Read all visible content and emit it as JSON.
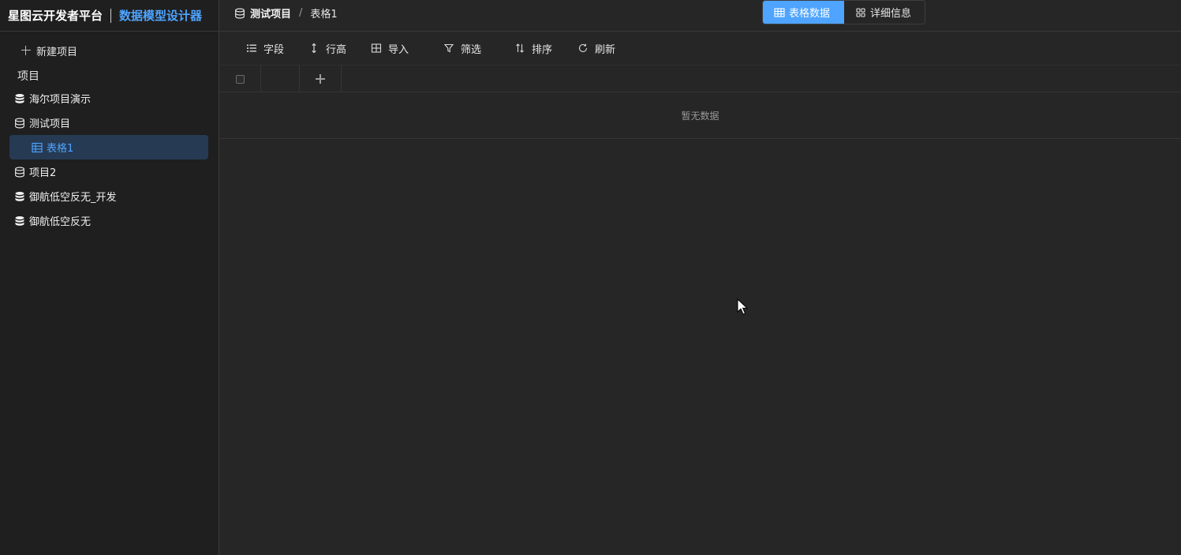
{
  "brand": {
    "name": "星图云开发者平台",
    "subtitle": "数据模型设计器"
  },
  "sidebar": {
    "new_project_label": "新建项目",
    "section_label": "项目",
    "items": [
      {
        "label": "海尔项目演示",
        "icon": "database-filled-icon"
      },
      {
        "label": "测试项目",
        "icon": "database-outline-icon"
      },
      {
        "label": "表格1",
        "icon": "table-icon",
        "selected": true
      },
      {
        "label": "项目2",
        "icon": "database-outline-icon"
      },
      {
        "label": "御航低空反无_开发",
        "icon": "database-filled-icon"
      },
      {
        "label": "御航低空反无",
        "icon": "database-filled-icon"
      }
    ]
  },
  "breadcrumb": {
    "project": "测试项目",
    "separator": "/",
    "table": "表格1"
  },
  "view_tabs": {
    "table_data": "表格数据",
    "details": "详细信息",
    "active": "table_data"
  },
  "toolbar": {
    "fields": "字段",
    "row_height": "行高",
    "import": "导入",
    "filter": "筛选",
    "sort": "排序",
    "refresh": "刷新"
  },
  "grid": {
    "empty_text": "暂无数据"
  },
  "colors": {
    "accent": "#4ea4ff",
    "selected_bg": "#263a54",
    "bg": "#262626",
    "sidebar_bg": "#1f1f1f"
  }
}
